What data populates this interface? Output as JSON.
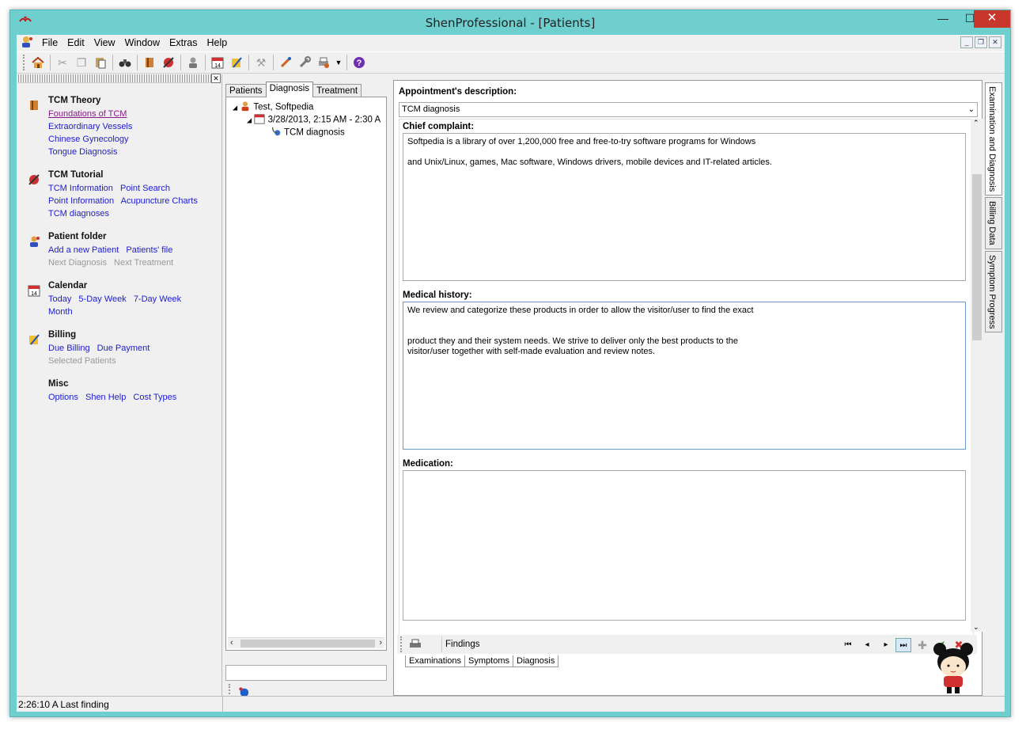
{
  "window": {
    "title": "ShenProfessional - [Patients]",
    "minimize": "—",
    "maximize": "☐",
    "close": "✕"
  },
  "menu": {
    "items": [
      "File",
      "Edit",
      "View",
      "Window",
      "Extras",
      "Help"
    ]
  },
  "toolbar": {
    "icons": [
      "home-icon",
      "cut-icon",
      "copy-icon",
      "paste-icon",
      "binoculars-icon",
      "book-icon",
      "acupuncture-icon",
      "patient-icon",
      "calendar-icon",
      "billing-icon",
      "tools-icon",
      "edit-icon",
      "wrench-icon",
      "print-icon",
      "help-icon"
    ]
  },
  "left": {
    "sections": [
      {
        "title": "TCM Theory",
        "links": [
          "Foundations of TCM",
          "Extraordinary Vessels",
          "Chinese Gynecology",
          "Tongue Diagnosis"
        ]
      },
      {
        "title": "TCM Tutorial",
        "links": [
          "TCM Information",
          "Point Search",
          "Point Information",
          "Acupuncture Charts",
          "TCM diagnoses"
        ]
      },
      {
        "title": "Patient folder",
        "links": [
          "Add a new Patient",
          "Patients' file",
          "Next Diagnosis",
          "Next Treatment"
        ]
      },
      {
        "title": "Calendar",
        "links": [
          "Today",
          "5-Day Week",
          "7-Day Week",
          "Month"
        ]
      },
      {
        "title": "Billing",
        "links": [
          "Due Billing",
          "Due Payment",
          "Selected Patients"
        ]
      },
      {
        "title": "Misc",
        "links": [
          "Options",
          "Shen Help",
          "Cost Types"
        ]
      }
    ]
  },
  "middle": {
    "tabs": [
      "Patients",
      "Diagnosis",
      "Treatment"
    ],
    "tree": {
      "patient": "Test, Softpedia",
      "appointment": "3/28/2013, 2:15 AM - 2:30 A",
      "item": "TCM diagnosis"
    }
  },
  "form": {
    "appointment_label": "Appointment's description:",
    "appointment_value": "TCM diagnosis",
    "chief_label": "Chief complaint:",
    "chief_text": "Softpedia is a library of over 1,200,000 free and free-to-try software programs for Windows\n\nand Unix/Linux, games, Mac software, Windows drivers, mobile devices and IT-related articles.",
    "history_label": "Medical history:",
    "history_text": "We review and categorize these products in order to allow the visitor/user to find the exact\n\n\nproduct they and their system needs. We strive to deliver only the best products to the\nvisitor/user together with self-made evaluation and review notes.",
    "medication_label": "Medication:",
    "medication_text": "",
    "findings": "Findings",
    "bottom_tabs": [
      "Examinations",
      "Symptoms",
      "Diagnosis"
    ]
  },
  "vertical_tabs": [
    "Examination and Diagnosis",
    "Billing Data",
    "Symptom Progress"
  ],
  "status": {
    "text": "2:26:10 A  Last finding"
  }
}
